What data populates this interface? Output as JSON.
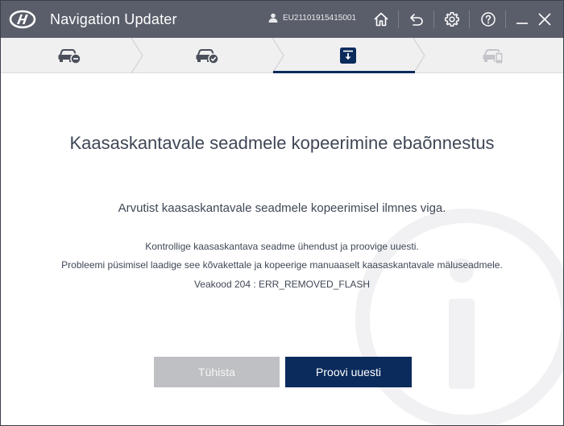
{
  "window": {
    "title": "Navigation Updater",
    "user_id": "EU21101915415001",
    "colors": {
      "titlebar": "#5a5e6a",
      "accent": "#0b2b5c",
      "stepbar": "#f0f0f1"
    }
  },
  "steps": [
    {
      "icon": "car-minus-icon",
      "state": "done"
    },
    {
      "icon": "car-check-icon",
      "state": "done"
    },
    {
      "icon": "download-box-icon",
      "state": "active"
    },
    {
      "icon": "car-device-icon",
      "state": "pending"
    }
  ],
  "message": {
    "heading": "Kaasaskantavale seadmele kopeerimine ebaõnnestus",
    "subheading": "Arvutist kaasaskantavale seadmele kopeerimisel ilmnes viga.",
    "line1": "Kontrollige kaasaskantava seadme ühendust ja proovige uuesti.",
    "line2": "Probleemi püsimisel laadige see kõvakettale ja kopeerige manuaaselt kaasaskantavale mäluseadmele.",
    "line3": "Veakood 204 : ERR_REMOVED_FLASH"
  },
  "buttons": {
    "cancel": "Tühista",
    "retry": "Proovi uuesti"
  }
}
